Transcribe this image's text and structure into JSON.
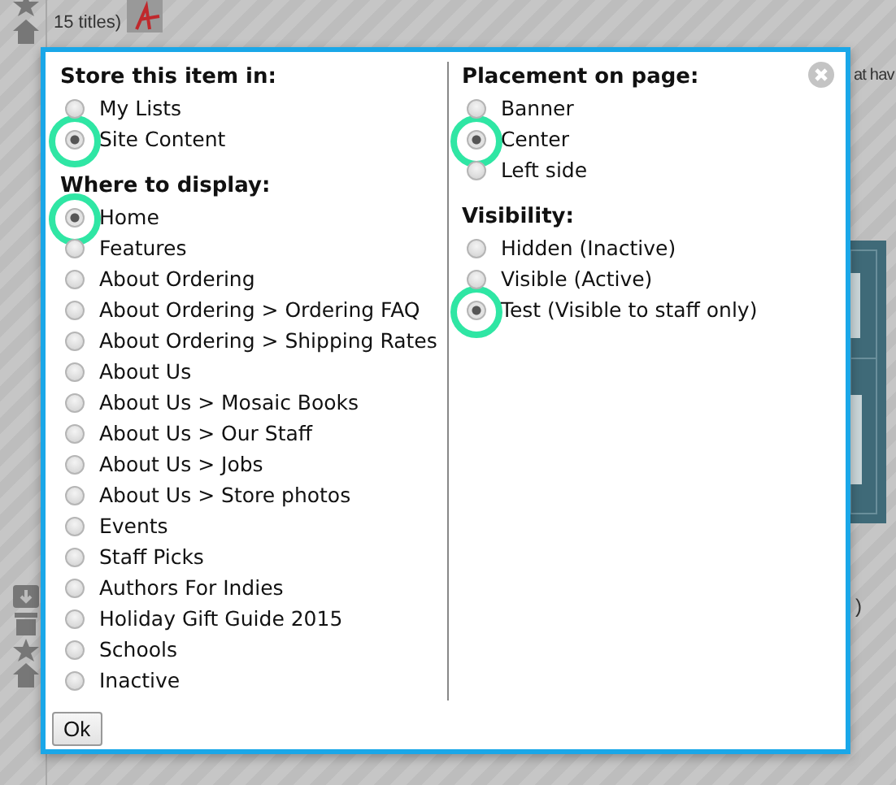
{
  "background": {
    "caption": "15 titles)",
    "fragment_right": "at hav",
    "fragment_paren": ")"
  },
  "dialog": {
    "columns": [
      {
        "groups": [
          {
            "heading": "Store this item in:",
            "options": [
              {
                "label": "My Lists",
                "selected": false,
                "highlighted": false
              },
              {
                "label": "Site Content",
                "selected": true,
                "highlighted": true
              }
            ]
          },
          {
            "heading": "Where to display:",
            "options": [
              {
                "label": "Home",
                "selected": true,
                "highlighted": true
              },
              {
                "label": "Features",
                "selected": false,
                "highlighted": false
              },
              {
                "label": "About Ordering",
                "selected": false,
                "highlighted": false
              },
              {
                "label": "About Ordering > Ordering FAQ",
                "selected": false,
                "highlighted": false
              },
              {
                "label": "About Ordering > Shipping Rates",
                "selected": false,
                "highlighted": false
              },
              {
                "label": "About Us",
                "selected": false,
                "highlighted": false
              },
              {
                "label": "About Us > Mosaic Books",
                "selected": false,
                "highlighted": false
              },
              {
                "label": "About Us > Our Staff",
                "selected": false,
                "highlighted": false
              },
              {
                "label": "About Us > Jobs",
                "selected": false,
                "highlighted": false
              },
              {
                "label": "About Us > Store photos",
                "selected": false,
                "highlighted": false
              },
              {
                "label": "Events",
                "selected": false,
                "highlighted": false
              },
              {
                "label": "Staff Picks",
                "selected": false,
                "highlighted": false
              },
              {
                "label": "Authors For Indies",
                "selected": false,
                "highlighted": false
              },
              {
                "label": "Holiday Gift Guide 2015",
                "selected": false,
                "highlighted": false
              },
              {
                "label": "Schools",
                "selected": false,
                "highlighted": false
              },
              {
                "label": "Inactive",
                "selected": false,
                "highlighted": false
              }
            ]
          }
        ]
      },
      {
        "groups": [
          {
            "heading": "Placement on page:",
            "options": [
              {
                "label": "Banner",
                "selected": false,
                "highlighted": false
              },
              {
                "label": "Center",
                "selected": true,
                "highlighted": true
              },
              {
                "label": "Left side",
                "selected": false,
                "highlighted": false
              }
            ]
          },
          {
            "heading": "Visibility:",
            "options": [
              {
                "label": "Hidden (Inactive)",
                "selected": false,
                "highlighted": false
              },
              {
                "label": "Visible (Active)",
                "selected": false,
                "highlighted": false
              },
              {
                "label": "Test (Visible to staff only)",
                "selected": true,
                "highlighted": true
              }
            ]
          }
        ]
      }
    ],
    "ok_button": "Ok"
  }
}
